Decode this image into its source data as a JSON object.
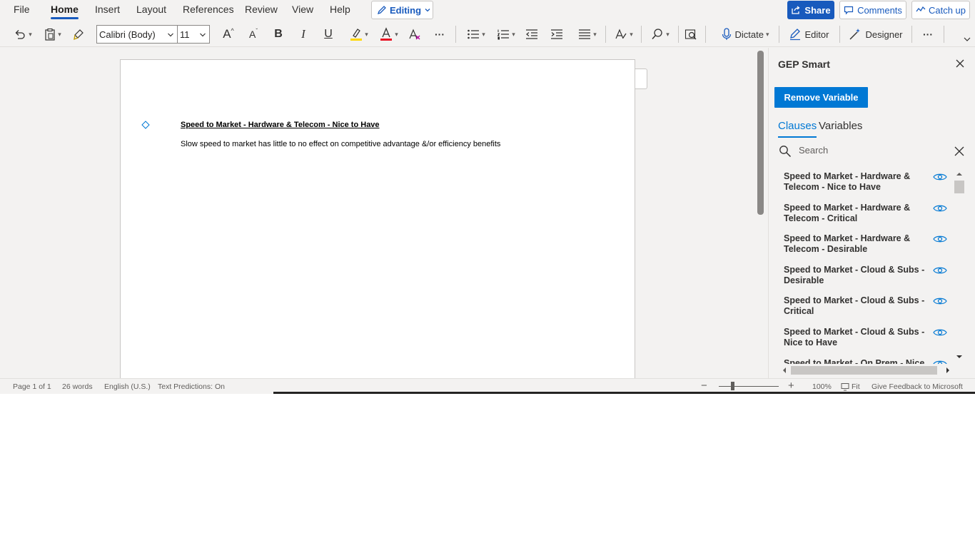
{
  "ribbon": {
    "tabs": [
      "File",
      "Home",
      "Insert",
      "Layout",
      "References",
      "Review",
      "View",
      "Help"
    ],
    "active_tab": "Home",
    "editing_label": "Editing",
    "share_label": "Share",
    "comments_label": "Comments",
    "catchup_label": "Catch up"
  },
  "toolbar": {
    "font_name": "Calibri (Body)",
    "font_size": "11",
    "bold_glyph": "B",
    "italic_glyph": "I",
    "underline_glyph": "U",
    "grow_glyph": "A",
    "shrink_glyph": "A",
    "more_glyph": "···",
    "dictate_label": "Dictate",
    "editor_label": "Editor",
    "designer_label": "Designer",
    "highlight_color": "#ffd700",
    "font_color": "#e81123"
  },
  "document": {
    "heading": "Speed to Market - Hardware & Telecom - Nice to Have",
    "body": "Slow speed to market has little to no effect on competitive advantage &/or efficiency benefits"
  },
  "pane": {
    "title": "GEP Smart",
    "remove_variable_label": "Remove Variable",
    "tabs": [
      "Clauses",
      "Variables"
    ],
    "search_placeholder": "Search",
    "clauses": [
      "Speed to Market - Hardware & Telecom - Nice to Have",
      "Speed to Market - Hardware & Telecom - Critical",
      "Speed to Market - Hardware & Telecom - Desirable",
      "Speed to Market - Cloud & Subs - Desirable",
      "Speed to Market - Cloud & Subs - Critical",
      "Speed to Market - Cloud & Subs - Nice to Have",
      "Speed to Market - On Prem - Nice to Have"
    ],
    "accent_color": "#0078d4"
  },
  "status": {
    "page": "Page 1 of 1",
    "words": "26 words",
    "language": "English (U.S.)",
    "predictions": "Text Predictions: On",
    "zoom": "100%",
    "fit_label": "Fit",
    "feedback": "Give Feedback to Microsoft",
    "zoom_out_glyph": "−",
    "zoom_in_glyph": "+"
  }
}
